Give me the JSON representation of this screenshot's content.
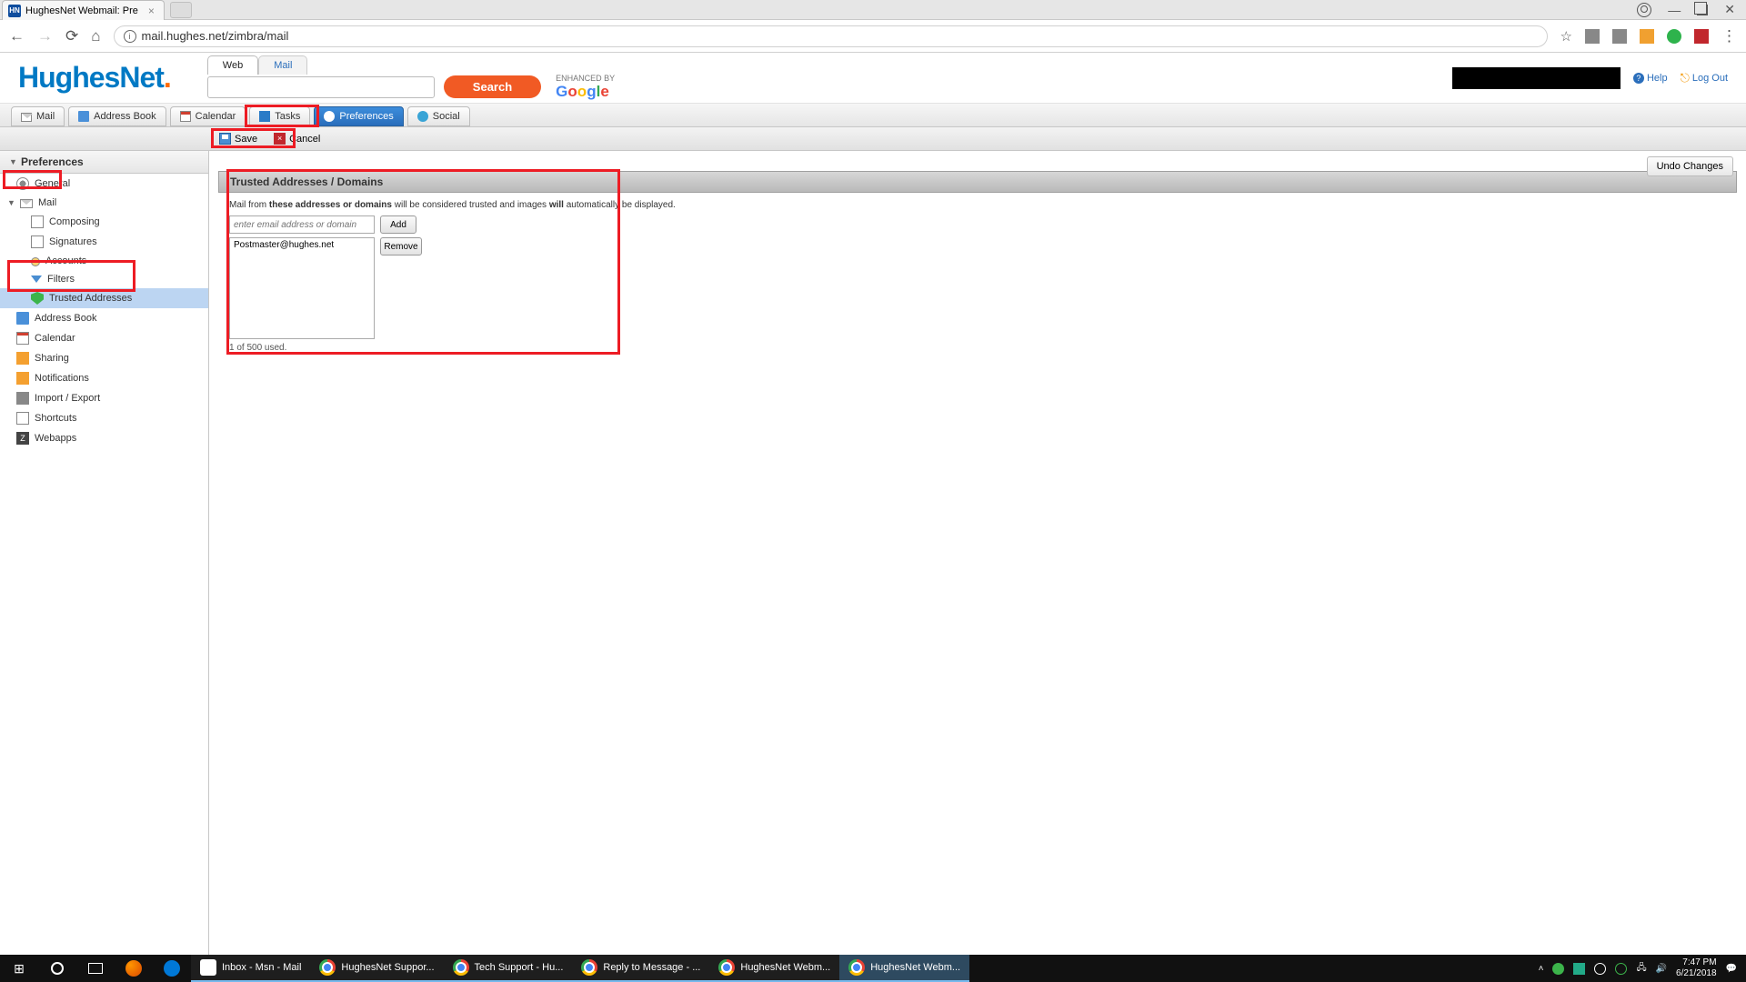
{
  "browser": {
    "tab_title": "HughesNet Webmail: Pre",
    "url": "mail.hughes.net/zimbra/mail",
    "win_controls": {
      "min": "—",
      "max": "❐",
      "close": "✕"
    }
  },
  "header": {
    "logo_main": "HughesNet",
    "logo_dot": ".",
    "search_tabs": {
      "web": "Web",
      "mail": "Mail"
    },
    "search_btn": "Search",
    "enhanced_by": "ENHANCED BY",
    "help": "Help",
    "logout": "Log Out"
  },
  "app_tabs": {
    "mail": "Mail",
    "addr": "Address Book",
    "cal": "Calendar",
    "tasks": "Tasks",
    "prefs": "Preferences",
    "social": "Social"
  },
  "actions": {
    "save": "Save",
    "cancel": "Cancel",
    "undo": "Undo Changes"
  },
  "sidebar": {
    "title": "Preferences",
    "general": "General",
    "mail": "Mail",
    "composing": "Composing",
    "signatures": "Signatures",
    "accounts": "Accounts",
    "filters": "Filters",
    "trusted": "Trusted Addresses",
    "address_book": "Address Book",
    "calendar": "Calendar",
    "sharing": "Sharing",
    "notifications": "Notifications",
    "import": "Import / Export",
    "shortcuts": "Shortcuts",
    "webapps": "Webapps"
  },
  "panel": {
    "title": "Trusted Addresses / Domains",
    "help_pre": "Mail from ",
    "help_b1": "these addresses or domains",
    "help_mid": " will be considered trusted and images ",
    "help_b2": "will",
    "help_post": " automatically be displayed.",
    "placeholder": "enter email address or domain",
    "add": "Add",
    "remove": "Remove",
    "entry": "Postmaster@hughes.net",
    "counter": "1 of 500 used."
  },
  "taskbar": {
    "items": [
      {
        "label": "Inbox - Msn - Mail"
      },
      {
        "label": "HughesNet Suppor..."
      },
      {
        "label": "Tech Support - Hu..."
      },
      {
        "label": "Reply to Message - ..."
      },
      {
        "label": "HughesNet Webm..."
      },
      {
        "label": "HughesNet Webm..."
      }
    ],
    "time": "7:47 PM",
    "date": "6/21/2018"
  }
}
